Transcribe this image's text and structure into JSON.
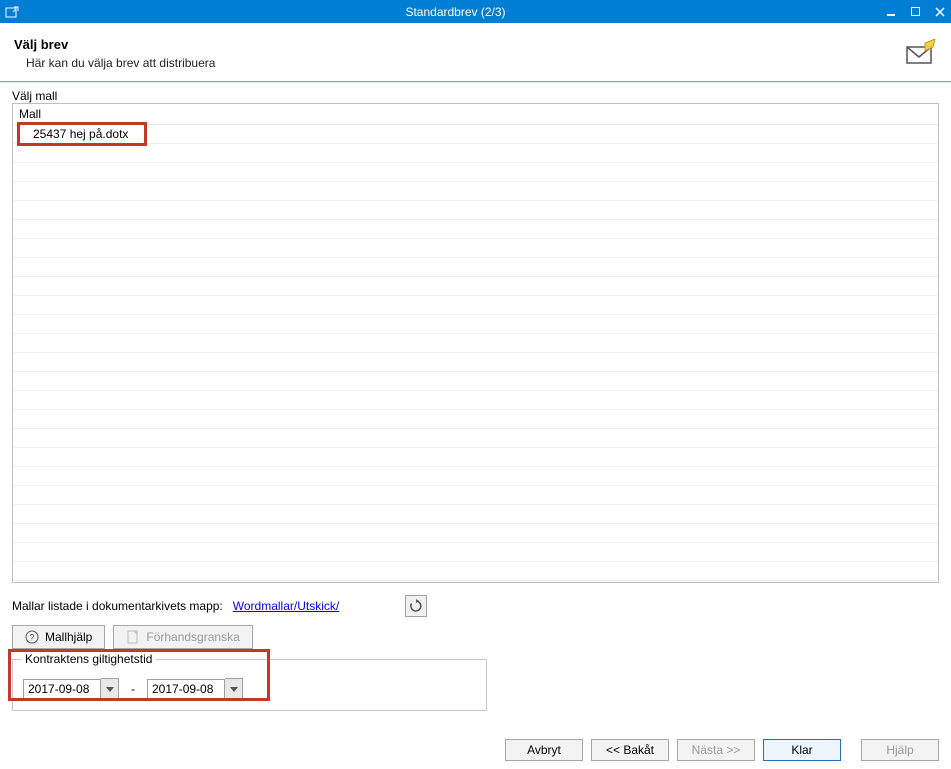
{
  "window": {
    "title": "Standardbrev (2/3)"
  },
  "header": {
    "title": "Välj brev",
    "subtitle": "Här kan du välja brev att distribuera"
  },
  "list_section": {
    "label": "Välj mall",
    "column_header": "Mall",
    "rows": [
      "25437 hej på.dotx"
    ]
  },
  "path_line": {
    "prefix": "Mallar listade i dokumentarkivets mapp:",
    "link": "Wordmallar/Utskick/"
  },
  "toolbar": {
    "help_label": "Mallhjälp",
    "preview_label": "Förhandsgranska"
  },
  "validity": {
    "legend": "Kontraktens giltighetstid",
    "from": "2017-09-08",
    "to": "2017-09-08"
  },
  "footer": {
    "cancel": "Avbryt",
    "back": "<< Bakåt",
    "next": "Nästa >>",
    "finish": "Klar",
    "help": "Hjälp"
  }
}
